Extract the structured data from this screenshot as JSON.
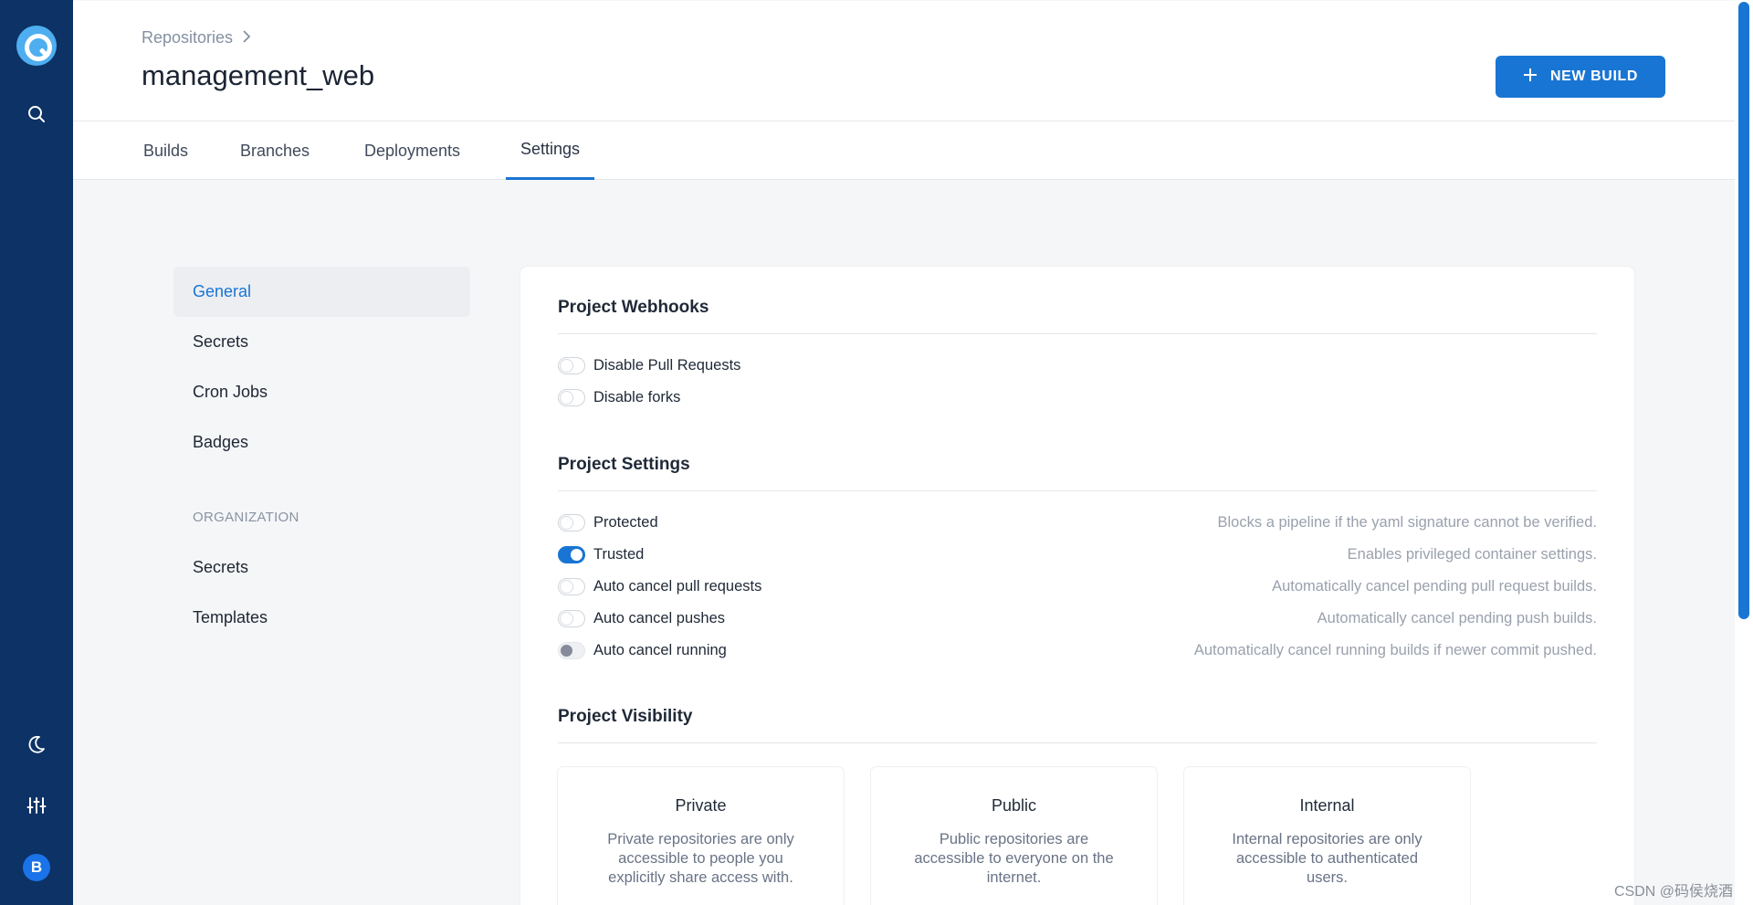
{
  "rail": {
    "logo_icon": "drone-logo-icon",
    "search_icon": "search-icon",
    "theme_icon": "moon-icon",
    "settings_icon": "sliders-icon",
    "avatar_initial": "B",
    "avatar_color": "#1a73e8",
    "background": "#0c3266"
  },
  "header": {
    "breadcrumb": "Repositories",
    "title": "management_web",
    "new_build_label": "NEW BUILD",
    "accent": "#1975d3"
  },
  "tabs": [
    {
      "label": "Builds",
      "active": false
    },
    {
      "label": "Branches",
      "active": false
    },
    {
      "label": "Deployments",
      "active": false
    },
    {
      "label": "Settings",
      "active": true
    }
  ],
  "settings_nav": {
    "items": [
      "General",
      "Secrets",
      "Cron Jobs",
      "Badges"
    ],
    "section": "ORGANIZATION",
    "org_items": [
      "Secrets",
      "Templates"
    ],
    "active": "General"
  },
  "webhooks": {
    "title": "Project Webhooks",
    "options": [
      {
        "label": "Disable Pull Requests",
        "enabled": false
      },
      {
        "label": "Disable forks",
        "enabled": false
      }
    ]
  },
  "project_settings": {
    "title": "Project Settings",
    "options": [
      {
        "label": "Protected",
        "enabled": false,
        "description": "Blocks a pipeline if the yaml signature cannot be verified."
      },
      {
        "label": "Trusted",
        "enabled": true,
        "description": "Enables privileged container settings."
      },
      {
        "label": "Auto cancel pull requests",
        "enabled": false,
        "description": "Automatically cancel pending pull request builds."
      },
      {
        "label": "Auto cancel pushes",
        "enabled": false,
        "description": "Automatically cancel pending push builds."
      },
      {
        "label": "Auto cancel running",
        "enabled": false,
        "disabled": true,
        "description": "Automatically cancel running builds if newer commit pushed."
      }
    ]
  },
  "visibility": {
    "title": "Project Visibility",
    "options": [
      {
        "title": "Private",
        "description": "Private repositories are only accessible to people you explicitly share access with."
      },
      {
        "title": "Public",
        "description": "Public repositories are accessible to everyone on the internet."
      },
      {
        "title": "Internal",
        "description": "Internal repositories are only accessible to authenticated users."
      }
    ]
  },
  "watermark": "CSDN @码侯烧酒"
}
